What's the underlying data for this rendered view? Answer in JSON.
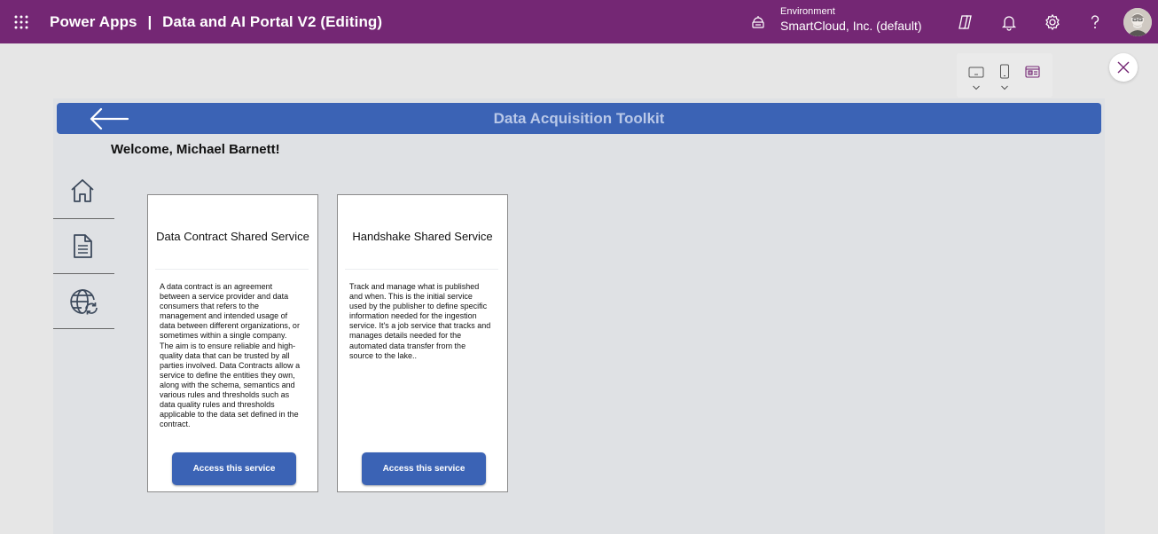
{
  "topbar": {
    "app_name": "Power Apps",
    "separator": "|",
    "app_title": "Data and AI Portal V2 (Editing)",
    "environment_label": "Environment",
    "environment_value": "SmartCloud, Inc. (default)",
    "icons": [
      "app-launcher-icon",
      "environment-icon",
      "copilot-icon",
      "bell-icon",
      "gear-icon",
      "help-icon"
    ],
    "accent_color": "#742774"
  },
  "app": {
    "header_title": "Data Acquisition Toolkit",
    "welcome": "Welcome, Michael Barnett!",
    "accent_color": "#3b63b5",
    "nav": [
      {
        "icon": "home-icon"
      },
      {
        "icon": "document-icon"
      },
      {
        "icon": "globe-sync-icon"
      }
    ],
    "cards": [
      {
        "title": "Data Contract Shared Service",
        "description": "A data contract is an agreement between a service provider and data consumers that refers to the management and intended usage of data between different organizations, or sometimes within a single company. The aim is to ensure reliable and high-quality data that can be trusted by all parties involved.  Data Contracts allow a service to define the entities they own, along with the schema, semantics and various rules and thresholds such as data quality rules and thresholds applicable to the data set defined in the contract.",
        "button": "Access this service"
      },
      {
        "title": "Handshake Shared Service",
        "description": "Track and manage what is published and when. This is the initial service used by the publisher to define specific information needed for the ingestion service. It's a job service that tracks and manages details needed for the automated data transfer from the source to the lake..",
        "button": "Access this service"
      }
    ]
  }
}
